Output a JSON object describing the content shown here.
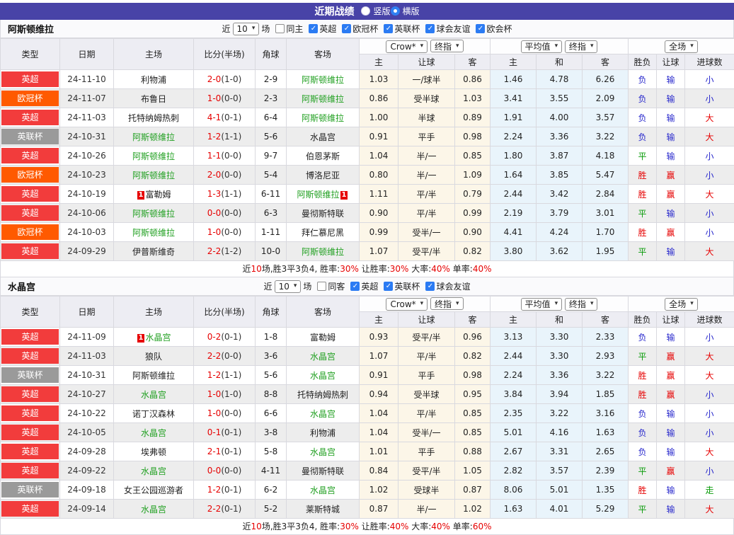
{
  "titlebar": {
    "title": "近期战绩",
    "radios": [
      {
        "label": "竖版",
        "selected": false
      },
      {
        "label": "横版",
        "selected": true
      }
    ]
  },
  "ui": {
    "near": "近",
    "games": "场",
    "check_glyph": "✓"
  },
  "table_headers": {
    "type": "类型",
    "date": "日期",
    "home": "主场",
    "score": "比分(半场)",
    "corners": "角球",
    "away": "客场",
    "odds_home": "主",
    "odds_hcp": "让球",
    "odds_away": "客",
    "avg_home": "主",
    "avg_draw": "和",
    "avg_away": "客",
    "res_wdl": "胜负",
    "res_hcp": "让球",
    "res_goals": "进球数",
    "dd_crow": "Crow*",
    "dd_final": "终指",
    "dd_avg": "平均值",
    "dd_final2": "终指",
    "dd_full": "全场"
  },
  "league_colors": {
    "英超": "#f23c3c",
    "欧冠杯": "#ff5a00",
    "英联杯": "#9a9a9a"
  },
  "result_colors": {
    "胜": "#e60000",
    "平": "#089b08",
    "负": "#2727cc",
    "赢": "#e60000",
    "输": "#2727cc",
    "大": "#e60000",
    "小": "#2727cc",
    "走": "#089b08"
  },
  "sections": [
    {
      "team": "阿斯顿维拉",
      "filter": {
        "games_value": "10",
        "same_label": "同主",
        "same_checked": false,
        "leagues": [
          {
            "label": "英超",
            "checked": true
          },
          {
            "label": "欧冠杯",
            "checked": true
          },
          {
            "label": "英联杯",
            "checked": true
          },
          {
            "label": "球会友谊",
            "checked": true
          },
          {
            "label": "欧会杯",
            "checked": true
          }
        ]
      },
      "rows": [
        {
          "league": "英超",
          "date": "24-11-10",
          "home": "利物浦",
          "home_self": false,
          "home_card": "",
          "score": "2-0",
          "half": "(1-0)",
          "corners": "2-9",
          "away": "阿斯顿维拉",
          "away_self": true,
          "away_card": "",
          "odds": [
            "1.03",
            "一/球半",
            "0.86"
          ],
          "avg": [
            "1.46",
            "4.78",
            "6.26"
          ],
          "results": [
            "负",
            "输",
            "小"
          ]
        },
        {
          "league": "欧冠杯",
          "date": "24-11-07",
          "home": "布鲁日",
          "home_self": false,
          "home_card": "",
          "score": "1-0",
          "half": "(0-0)",
          "corners": "2-3",
          "away": "阿斯顿维拉",
          "away_self": true,
          "away_card": "",
          "odds": [
            "0.86",
            "受半球",
            "1.03"
          ],
          "avg": [
            "3.41",
            "3.55",
            "2.09"
          ],
          "results": [
            "负",
            "输",
            "小"
          ]
        },
        {
          "league": "英超",
          "date": "24-11-03",
          "home": "托特纳姆热刺",
          "home_self": false,
          "home_card": "",
          "score": "4-1",
          "half": "(0-1)",
          "corners": "6-4",
          "away": "阿斯顿维拉",
          "away_self": true,
          "away_card": "",
          "odds": [
            "1.00",
            "半球",
            "0.89"
          ],
          "avg": [
            "1.91",
            "4.00",
            "3.57"
          ],
          "results": [
            "负",
            "输",
            "大"
          ]
        },
        {
          "league": "英联杯",
          "date": "24-10-31",
          "home": "阿斯顿维拉",
          "home_self": true,
          "home_card": "",
          "score": "1-2",
          "half": "(1-1)",
          "corners": "5-6",
          "away": "水晶宫",
          "away_self": false,
          "away_card": "",
          "odds": [
            "0.91",
            "平手",
            "0.98"
          ],
          "avg": [
            "2.24",
            "3.36",
            "3.22"
          ],
          "results": [
            "负",
            "输",
            "大"
          ]
        },
        {
          "league": "英超",
          "date": "24-10-26",
          "home": "阿斯顿维拉",
          "home_self": true,
          "home_card": "",
          "score": "1-1",
          "half": "(0-0)",
          "corners": "9-7",
          "away": "伯恩茅斯",
          "away_self": false,
          "away_card": "",
          "odds": [
            "1.04",
            "半/一",
            "0.85"
          ],
          "avg": [
            "1.80",
            "3.87",
            "4.18"
          ],
          "results": [
            "平",
            "输",
            "小"
          ]
        },
        {
          "league": "欧冠杯",
          "date": "24-10-23",
          "home": "阿斯顿维拉",
          "home_self": true,
          "home_card": "",
          "score": "2-0",
          "half": "(0-0)",
          "corners": "5-4",
          "away": "博洛尼亚",
          "away_self": false,
          "away_card": "",
          "odds": [
            "0.80",
            "半/一",
            "1.09"
          ],
          "avg": [
            "1.64",
            "3.85",
            "5.47"
          ],
          "results": [
            "胜",
            "赢",
            "小"
          ]
        },
        {
          "league": "英超",
          "date": "24-10-19",
          "home": "富勒姆",
          "home_self": false,
          "home_card": "1",
          "score": "1-3",
          "half": "(1-1)",
          "corners": "6-11",
          "away": "阿斯顿维拉",
          "away_self": true,
          "away_card": "1",
          "odds": [
            "1.11",
            "平/半",
            "0.79"
          ],
          "avg": [
            "2.44",
            "3.42",
            "2.84"
          ],
          "results": [
            "胜",
            "赢",
            "大"
          ]
        },
        {
          "league": "英超",
          "date": "24-10-06",
          "home": "阿斯顿维拉",
          "home_self": true,
          "home_card": "",
          "score": "0-0",
          "half": "(0-0)",
          "corners": "6-3",
          "away": "曼彻斯特联",
          "away_self": false,
          "away_card": "",
          "odds": [
            "0.90",
            "平/半",
            "0.99"
          ],
          "avg": [
            "2.19",
            "3.79",
            "3.01"
          ],
          "results": [
            "平",
            "输",
            "小"
          ]
        },
        {
          "league": "欧冠杯",
          "date": "24-10-03",
          "home": "阿斯顿维拉",
          "home_self": true,
          "home_card": "",
          "score": "1-0",
          "half": "(0-0)",
          "corners": "1-11",
          "away": "拜仁慕尼黑",
          "away_self": false,
          "away_card": "",
          "odds": [
            "0.99",
            "受半/一",
            "0.90"
          ],
          "avg": [
            "4.41",
            "4.24",
            "1.70"
          ],
          "results": [
            "胜",
            "赢",
            "小"
          ]
        },
        {
          "league": "英超",
          "date": "24-09-29",
          "home": "伊普斯维奇",
          "home_self": false,
          "home_card": "",
          "score": "2-2",
          "half": "(1-2)",
          "corners": "10-0",
          "away": "阿斯顿维拉",
          "away_self": true,
          "away_card": "",
          "odds": [
            "1.07",
            "受平/半",
            "0.82"
          ],
          "avg": [
            "3.80",
            "3.62",
            "1.95"
          ],
          "results": [
            "平",
            "输",
            "大"
          ]
        }
      ],
      "summary": [
        {
          "t": "近",
          "red": false
        },
        {
          "t": "10",
          "red": true
        },
        {
          "t": "场,胜3平3负4, 胜率:",
          "red": false
        },
        {
          "t": "30%",
          "red": true
        },
        {
          "t": " 让胜率:",
          "red": false
        },
        {
          "t": "30%",
          "red": true
        },
        {
          "t": " 大率:",
          "red": false
        },
        {
          "t": "40%",
          "red": true
        },
        {
          "t": " 单率:",
          "red": false
        },
        {
          "t": "40%",
          "red": true
        }
      ]
    },
    {
      "team": "水晶宫",
      "filter": {
        "games_value": "10",
        "same_label": "同客",
        "same_checked": false,
        "leagues": [
          {
            "label": "英超",
            "checked": true
          },
          {
            "label": "英联杯",
            "checked": true
          },
          {
            "label": "球会友谊",
            "checked": true
          }
        ]
      },
      "rows": [
        {
          "league": "英超",
          "date": "24-11-09",
          "home": "水晶宫",
          "home_self": true,
          "home_card": "1",
          "score": "0-2",
          "half": "(0-1)",
          "corners": "1-8",
          "away": "富勒姆",
          "away_self": false,
          "away_card": "",
          "odds": [
            "0.93",
            "受平/半",
            "0.96"
          ],
          "avg": [
            "3.13",
            "3.30",
            "2.33"
          ],
          "results": [
            "负",
            "输",
            "小"
          ]
        },
        {
          "league": "英超",
          "date": "24-11-03",
          "home": "狼队",
          "home_self": false,
          "home_card": "",
          "score": "2-2",
          "half": "(0-0)",
          "corners": "3-6",
          "away": "水晶宫",
          "away_self": true,
          "away_card": "",
          "odds": [
            "1.07",
            "平/半",
            "0.82"
          ],
          "avg": [
            "2.44",
            "3.30",
            "2.93"
          ],
          "results": [
            "平",
            "赢",
            "大"
          ]
        },
        {
          "league": "英联杯",
          "date": "24-10-31",
          "home": "阿斯顿维拉",
          "home_self": false,
          "home_card": "",
          "score": "1-2",
          "half": "(1-1)",
          "corners": "5-6",
          "away": "水晶宫",
          "away_self": true,
          "away_card": "",
          "odds": [
            "0.91",
            "平手",
            "0.98"
          ],
          "avg": [
            "2.24",
            "3.36",
            "3.22"
          ],
          "results": [
            "胜",
            "赢",
            "大"
          ]
        },
        {
          "league": "英超",
          "date": "24-10-27",
          "home": "水晶宫",
          "home_self": true,
          "home_card": "",
          "score": "1-0",
          "half": "(1-0)",
          "corners": "8-8",
          "away": "托特纳姆热刺",
          "away_self": false,
          "away_card": "",
          "odds": [
            "0.94",
            "受半球",
            "0.95"
          ],
          "avg": [
            "3.84",
            "3.94",
            "1.85"
          ],
          "results": [
            "胜",
            "赢",
            "小"
          ]
        },
        {
          "league": "英超",
          "date": "24-10-22",
          "home": "诺丁汉森林",
          "home_self": false,
          "home_card": "",
          "score": "1-0",
          "half": "(0-0)",
          "corners": "6-6",
          "away": "水晶宫",
          "away_self": true,
          "away_card": "",
          "odds": [
            "1.04",
            "平/半",
            "0.85"
          ],
          "avg": [
            "2.35",
            "3.22",
            "3.16"
          ],
          "results": [
            "负",
            "输",
            "小"
          ]
        },
        {
          "league": "英超",
          "date": "24-10-05",
          "home": "水晶宫",
          "home_self": true,
          "home_card": "",
          "score": "0-1",
          "half": "(0-1)",
          "corners": "3-8",
          "away": "利物浦",
          "away_self": false,
          "away_card": "",
          "odds": [
            "1.04",
            "受半/一",
            "0.85"
          ],
          "avg": [
            "5.01",
            "4.16",
            "1.63"
          ],
          "results": [
            "负",
            "输",
            "小"
          ]
        },
        {
          "league": "英超",
          "date": "24-09-28",
          "home": "埃弗顿",
          "home_self": false,
          "home_card": "",
          "score": "2-1",
          "half": "(0-1)",
          "corners": "5-8",
          "away": "水晶宫",
          "away_self": true,
          "away_card": "",
          "odds": [
            "1.01",
            "平手",
            "0.88"
          ],
          "avg": [
            "2.67",
            "3.31",
            "2.65"
          ],
          "results": [
            "负",
            "输",
            "大"
          ]
        },
        {
          "league": "英超",
          "date": "24-09-22",
          "home": "水晶宫",
          "home_self": true,
          "home_card": "",
          "score": "0-0",
          "half": "(0-0)",
          "corners": "4-11",
          "away": "曼彻斯特联",
          "away_self": false,
          "away_card": "",
          "odds": [
            "0.84",
            "受平/半",
            "1.05"
          ],
          "avg": [
            "2.82",
            "3.57",
            "2.39"
          ],
          "results": [
            "平",
            "赢",
            "小"
          ]
        },
        {
          "league": "英联杯",
          "date": "24-09-18",
          "home": "女王公园巡游者",
          "home_self": false,
          "home_card": "",
          "score": "1-2",
          "half": "(0-1)",
          "corners": "6-2",
          "away": "水晶宫",
          "away_self": true,
          "away_card": "",
          "odds": [
            "1.02",
            "受球半",
            "0.87"
          ],
          "avg": [
            "8.06",
            "5.01",
            "1.35"
          ],
          "results": [
            "胜",
            "输",
            "走"
          ]
        },
        {
          "league": "英超",
          "date": "24-09-14",
          "home": "水晶宫",
          "home_self": true,
          "home_card": "",
          "score": "2-2",
          "half": "(0-1)",
          "corners": "5-2",
          "away": "莱斯特城",
          "away_self": false,
          "away_card": "",
          "odds": [
            "0.87",
            "半/一",
            "1.02"
          ],
          "avg": [
            "1.63",
            "4.01",
            "5.29"
          ],
          "results": [
            "平",
            "输",
            "大"
          ]
        }
      ],
      "summary": [
        {
          "t": "近",
          "red": false
        },
        {
          "t": "10",
          "red": true
        },
        {
          "t": "场,胜3平3负4, 胜率:",
          "red": false
        },
        {
          "t": "30%",
          "red": true
        },
        {
          "t": " 让胜率:",
          "red": false
        },
        {
          "t": "40%",
          "red": true
        },
        {
          "t": " 大率:",
          "red": false
        },
        {
          "t": "40%",
          "red": true
        },
        {
          "t": " 单率:",
          "red": false
        },
        {
          "t": "60%",
          "red": true
        }
      ]
    }
  ]
}
